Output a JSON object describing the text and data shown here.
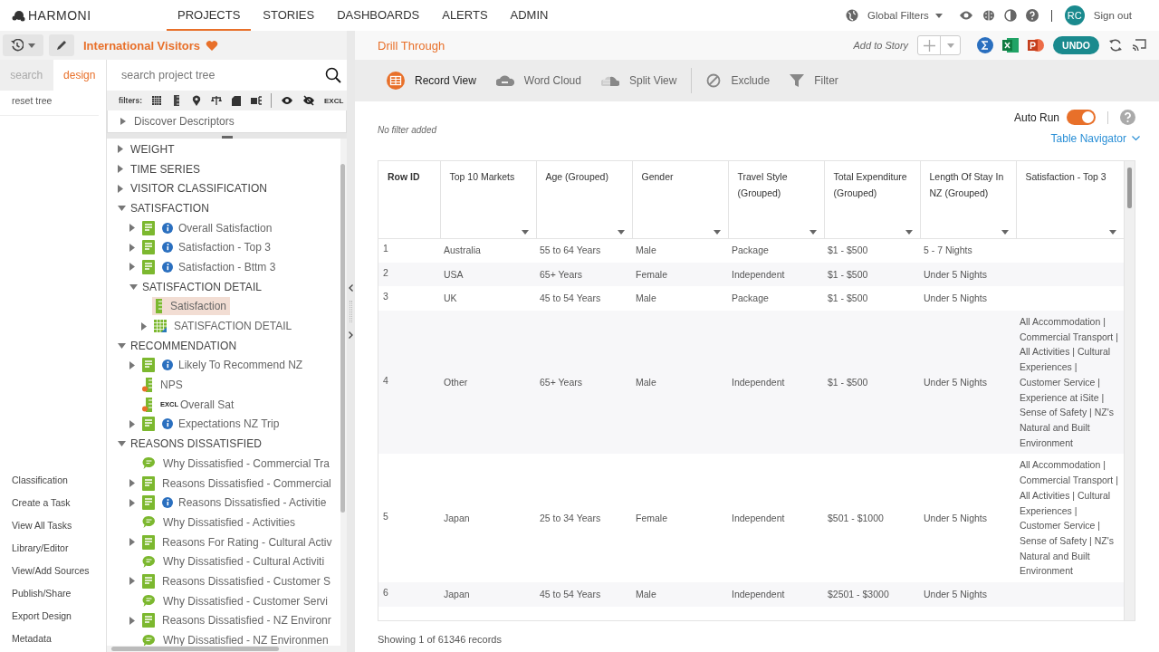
{
  "app": {
    "logo": "HARMONI"
  },
  "nav": [
    {
      "label": "PROJECTS",
      "selected": true
    },
    {
      "label": "STORIES",
      "selected": false
    },
    {
      "label": "DASHBOARDS",
      "selected": false
    },
    {
      "label": "ALERTS",
      "selected": false
    },
    {
      "label": "ADMIN",
      "selected": false
    }
  ],
  "header_right": {
    "global_filters": "Global Filters",
    "avatar": "RC",
    "sign_out": "Sign out"
  },
  "project": {
    "title": "International Visitors",
    "favorite": true
  },
  "side_tabs": [
    {
      "label": "search",
      "selected": false
    },
    {
      "label": "design",
      "selected": true
    }
  ],
  "reset_tree": "reset tree",
  "side_links": [
    "Classification",
    "Create a Task",
    "View All Tasks",
    "Library/Editor",
    "View/Add Sources",
    "Publish/Share",
    "Export Design",
    "Metadata"
  ],
  "tree_search": {
    "placeholder": "search project tree"
  },
  "filters": {
    "label": "filters:",
    "excl": "EXCL"
  },
  "discover": "Discover Descriptors",
  "tree": [
    {
      "label": "WEIGHT",
      "kind": "folder",
      "expanded": false,
      "selected": false
    },
    {
      "label": "TIME SERIES",
      "kind": "folder",
      "expanded": false,
      "selected": false
    },
    {
      "label": "VISITOR CLASSIFICATION",
      "kind": "folder",
      "expanded": false,
      "selected": false
    },
    {
      "label": "SATISFACTION",
      "kind": "folder",
      "expanded": true,
      "selected": false,
      "children": [
        {
          "label": "Overall Satisfaction",
          "kind": "list",
          "info": true,
          "expanded": false,
          "selected": false
        },
        {
          "label": "Satisfaction - Top 3",
          "kind": "list",
          "info": true,
          "expanded": false,
          "selected": false
        },
        {
          "label": "Satisfaction - Bttm 3",
          "kind": "list",
          "info": true,
          "expanded": false,
          "selected": false
        },
        {
          "label": "SATISFACTION DETAIL",
          "kind": "folder",
          "expanded": true,
          "selected": false,
          "children": [
            {
              "label": "Satisfaction",
              "kind": "ruler",
              "info": false,
              "selected": true
            },
            {
              "label": "SATISFACTION DETAIL",
              "kind": "grid",
              "info": false,
              "expanded": false,
              "selected": false
            }
          ]
        }
      ]
    },
    {
      "label": "RECOMMENDATION",
      "kind": "folder",
      "expanded": true,
      "selected": false,
      "children": [
        {
          "label": "Likely To Recommend NZ",
          "kind": "list",
          "info": true,
          "expanded": false,
          "selected": false
        },
        {
          "label": "NPS",
          "kind": "metric",
          "info": false,
          "selected": false
        },
        {
          "label": "Overall Sat",
          "kind": "metric",
          "info": false,
          "badge": "EXCL",
          "selected": false
        },
        {
          "label": "Expectations NZ Trip",
          "kind": "list",
          "info": true,
          "expanded": false,
          "selected": false
        }
      ]
    },
    {
      "label": "REASONS DISSATISFIED",
      "kind": "folder",
      "expanded": true,
      "selected": false,
      "children": [
        {
          "label": "Why Dissatisfied - Commercial Tra",
          "kind": "comment",
          "info": false,
          "selected": false
        },
        {
          "label": "Reasons Dissatisfied - Commercial",
          "kind": "list",
          "info": false,
          "expanded": false,
          "selected": false
        },
        {
          "label": "Reasons Dissatisfied - Activitie",
          "kind": "list",
          "info": true,
          "expanded": false,
          "selected": false
        },
        {
          "label": "Why Dissatisfied - Activities",
          "kind": "comment",
          "info": false,
          "selected": false
        },
        {
          "label": "Reasons For Rating - Cultural Activ",
          "kind": "list",
          "info": false,
          "expanded": false,
          "selected": false
        },
        {
          "label": "Why Dissatisfied - Cultural Activiti",
          "kind": "comment",
          "info": false,
          "selected": false
        },
        {
          "label": "Reasons Dissatisfied - Customer S",
          "kind": "list",
          "info": false,
          "expanded": false,
          "selected": false
        },
        {
          "label": "Why Dissatisfied - Customer Servi",
          "kind": "comment",
          "info": false,
          "selected": false
        },
        {
          "label": "Reasons Dissatisfied - NZ Environr",
          "kind": "list",
          "info": false,
          "expanded": false,
          "selected": false
        },
        {
          "label": "Why Dissatisfied - NZ Environmen",
          "kind": "comment",
          "info": false,
          "selected": false
        }
      ]
    }
  ],
  "panel": {
    "title": "Drill Through",
    "add_to_story": "Add to Story",
    "undo": "UNDO"
  },
  "views": [
    {
      "label": "Record View",
      "kind": "table",
      "selected": true
    },
    {
      "label": "Word Cloud",
      "kind": "cloud",
      "selected": false
    },
    {
      "label": "Split View",
      "kind": "split",
      "selected": false
    }
  ],
  "actions": [
    {
      "label": "Exclude",
      "kind": "exclude"
    },
    {
      "label": "Filter",
      "kind": "filter"
    }
  ],
  "filter_note": "No filter added",
  "auto_run": {
    "label": "Auto Run",
    "on": true
  },
  "table_navigator": "Table Navigator",
  "table": {
    "columns": [
      {
        "label": "Row ID",
        "menu": false
      },
      {
        "label": "Top 10 Markets",
        "menu": true
      },
      {
        "label": "Age (Grouped)",
        "menu": true
      },
      {
        "label": "Gender",
        "menu": true
      },
      {
        "label": "Travel Style (Grouped)",
        "menu": true
      },
      {
        "label": "Total Expenditure (Grouped)",
        "menu": true
      },
      {
        "label": "Length Of Stay In NZ (Grouped)",
        "menu": true
      },
      {
        "label": "Satisfaction - Top 3",
        "menu": true
      }
    ],
    "rows": [
      {
        "cells": [
          "1",
          "Australia",
          "55 to 64 Years",
          "Male",
          "Package",
          "$1 - $500",
          "5 - 7 Nights"
        ]
      },
      {
        "cells": [
          "2",
          "USA",
          "65+ Years",
          "Female",
          "Independent",
          "$1 - $500",
          "Under 5 Nights"
        ]
      },
      {
        "cells": [
          "3",
          "UK",
          "45 to 54 Years",
          "Male",
          "Package",
          "$1 - $500",
          "Under 5 Nights"
        ]
      },
      {
        "cells": [
          "4",
          "Other",
          "65+ Years",
          "Male",
          "Independent",
          "$1 - $500",
          "Under 5 Nights",
          "All Accommodation | Commercial Transport | All Activities | Cultural Experiences | Customer Service | Experience at iSite | Sense of Safety | NZ's Natural and Built Environment"
        ]
      },
      {
        "cells": [
          "5",
          "Japan",
          "25 to 34 Years",
          "Female",
          "Independent",
          "$501 - $1000",
          "Under 5 Nights",
          "All Accommodation | Commercial Transport | All Activities | Cultural Experiences | Customer Service | Sense of Safety | NZ's Natural and Built Environment"
        ]
      },
      {
        "cells": [
          "6",
          "Japan",
          "45 to 54 Years",
          "Male",
          "Independent",
          "$2501 - $3000",
          "Under 5 Nights"
        ]
      }
    ]
  },
  "status": "Showing 1 of 61346 records"
}
